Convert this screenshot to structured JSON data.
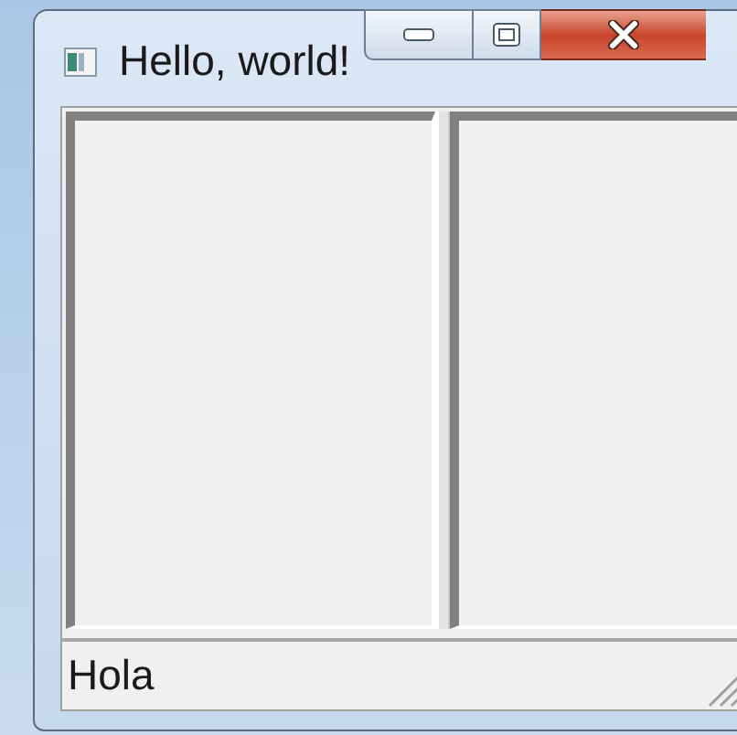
{
  "window": {
    "title": "Hello, world!"
  },
  "status_bar": {
    "text": "Hola"
  }
}
